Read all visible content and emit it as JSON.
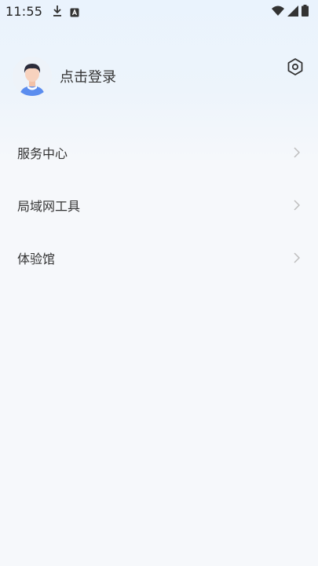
{
  "status_bar": {
    "time": "11:55",
    "left_icons": [
      "download-icon",
      "a-box-icon"
    ],
    "right_icons": [
      "wifi-icon",
      "signal-icon",
      "battery-icon"
    ]
  },
  "profile": {
    "login_text": "点击登录",
    "avatar_icon": "user-avatar-icon",
    "settings_icon": "settings-icon"
  },
  "menu": {
    "items": [
      {
        "label": "服务中心",
        "icon": "chevron-right-icon"
      },
      {
        "label": "局域网工具",
        "icon": "chevron-right-icon"
      },
      {
        "label": "体验馆",
        "icon": "chevron-right-icon"
      }
    ]
  },
  "colors": {
    "background": "#F6F8FB",
    "header_gradient_top": "#EAF3FD",
    "text_primary": "#333333",
    "chevron": "#BDBDBD"
  }
}
